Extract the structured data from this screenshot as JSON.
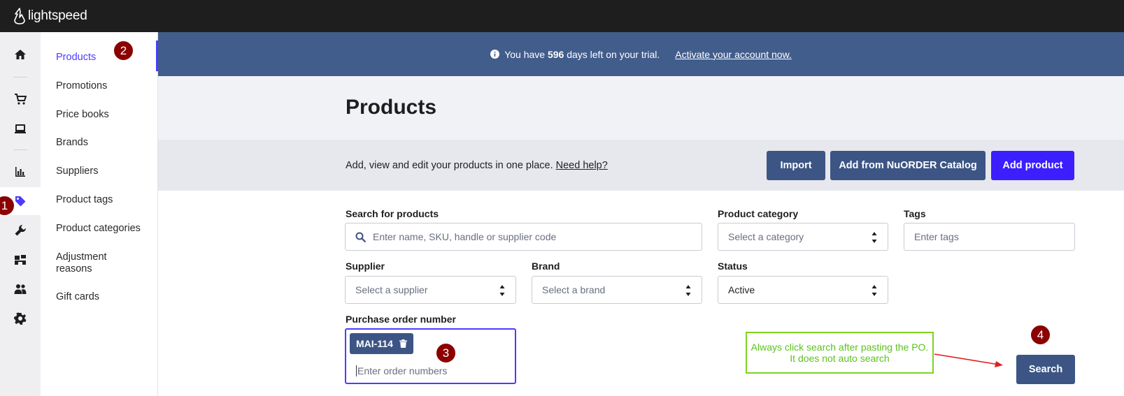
{
  "app": {
    "brand": "lightspeed"
  },
  "colors": {
    "topbar": "#1e1e1e",
    "accent": "#4b3cff",
    "navy": "#3c5585",
    "banner": "#415d8c",
    "annotation_badge": "#8b0000",
    "note_green": "#7ed321",
    "arrow": "#e02020"
  },
  "rail": {
    "items": [
      {
        "icon": "home-icon",
        "active": false
      },
      {
        "icon": "cart-icon",
        "active": false
      },
      {
        "icon": "register-icon",
        "active": false
      },
      {
        "icon": "bar-chart-icon",
        "active": false
      },
      {
        "icon": "tag-icon",
        "active": true
      },
      {
        "icon": "wrench-icon",
        "active": false
      },
      {
        "icon": "store-icon",
        "active": false
      },
      {
        "icon": "users-icon",
        "active": false
      },
      {
        "icon": "gear-icon",
        "active": false
      }
    ]
  },
  "subnav": {
    "items": [
      {
        "label": "Products",
        "active": true
      },
      {
        "label": "Promotions"
      },
      {
        "label": "Price books"
      },
      {
        "label": "Brands"
      },
      {
        "label": "Suppliers"
      },
      {
        "label": "Product tags"
      },
      {
        "label": "Product categories"
      },
      {
        "label": "Adjustment reasons"
      },
      {
        "label": "Gift cards"
      }
    ]
  },
  "banner": {
    "prefix": "You have",
    "days": "596",
    "suffix": "days left on your trial.",
    "link": "Activate your account now."
  },
  "page": {
    "title": "Products",
    "description": "Add, view and edit your products in one place.",
    "help_link": "Need help?"
  },
  "toolbar": {
    "import_label": "Import",
    "nuorder_label": "Add from NuORDER Catalog",
    "add_product_label": "Add product"
  },
  "filters": {
    "search": {
      "label": "Search for products",
      "placeholder": "Enter name, SKU, handle or supplier code"
    },
    "category": {
      "label": "Product category",
      "placeholder": "Select a category"
    },
    "tags": {
      "label": "Tags",
      "placeholder": "Enter tags"
    },
    "supplier": {
      "label": "Supplier",
      "placeholder": "Select a supplier"
    },
    "brand": {
      "label": "Brand",
      "placeholder": "Select a brand"
    },
    "status": {
      "label": "Status",
      "value": "Active"
    },
    "po": {
      "label": "Purchase order number",
      "tag": "MAI-114",
      "placeholder": "Enter order numbers"
    },
    "search_button": "Search"
  },
  "annotations": {
    "badges": [
      "1",
      "2",
      "3",
      "4"
    ],
    "note": "Always click search after pasting the PO. It does not auto search"
  }
}
